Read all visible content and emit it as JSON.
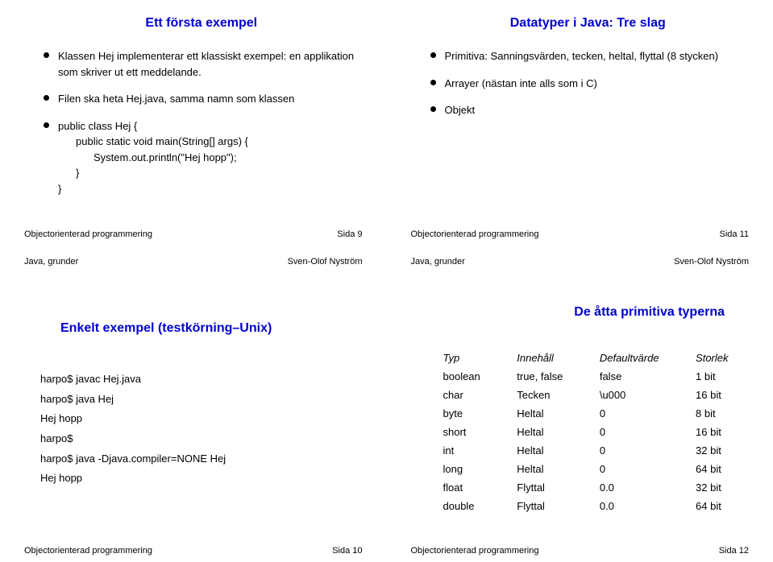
{
  "footer_course": "Objectorienterad programmering",
  "footer_topic": "Java, grunder",
  "footer_author": "Sven-Olof Nyström",
  "pages": {
    "p9": "Sida 9",
    "p10": "Sida 10",
    "p11": "Sida 11",
    "p12": "Sida 12"
  },
  "q1": {
    "heading": "Ett första exempel",
    "b1": "Klassen Hej implementerar ett klassiskt exempel: en applikation som skriver ut ett meddelande.",
    "b2": "Filen ska heta Hej.java, samma namn som klassen",
    "b3_l1": "public class Hej {",
    "b3_l2": "public static void main(String[] args) {",
    "b3_l3": "System.out.println(\"Hej hopp\");",
    "b3_l4": "}",
    "b3_l5": "}"
  },
  "q2": {
    "heading": "Datatyper i Java: Tre slag",
    "b1": "Primitiva: Sanningsvärden, tecken, heltal, flyttal (8 stycken)",
    "b2": "Arrayer (nästan inte alls som i C)",
    "b3": "Objekt"
  },
  "q3": {
    "heading": "Enkelt exempel (testkörning–Unix)",
    "l1": "harpo$ javac Hej.java",
    "l2": "harpo$ java Hej",
    "l3": "Hej hopp",
    "l4": "harpo$",
    "l5": "harpo$ java -Djava.compiler=NONE Hej",
    "l6": "Hej hopp"
  },
  "q4": {
    "heading": "De åtta primitiva typerna",
    "th1": "Typ",
    "th2": "Innehåll",
    "th3": "Defaultvärde",
    "th4": "Storlek",
    "rows": [
      {
        "t": "boolean",
        "i": "true, false",
        "d": "false",
        "s": "1 bit"
      },
      {
        "t": "char",
        "i": "Tecken",
        "d": "\\u000",
        "s": "16 bit"
      },
      {
        "t": "byte",
        "i": "Heltal",
        "d": "0",
        "s": "8 bit"
      },
      {
        "t": "short",
        "i": "Heltal",
        "d": "0",
        "s": "16 bit"
      },
      {
        "t": "int",
        "i": "Heltal",
        "d": "0",
        "s": "32 bit"
      },
      {
        "t": "long",
        "i": "Heltal",
        "d": "0",
        "s": "64 bit"
      },
      {
        "t": "float",
        "i": "Flyttal",
        "d": "0.0",
        "s": "32 bit"
      },
      {
        "t": "double",
        "i": "Flyttal",
        "d": "0.0",
        "s": "64 bit"
      }
    ]
  }
}
